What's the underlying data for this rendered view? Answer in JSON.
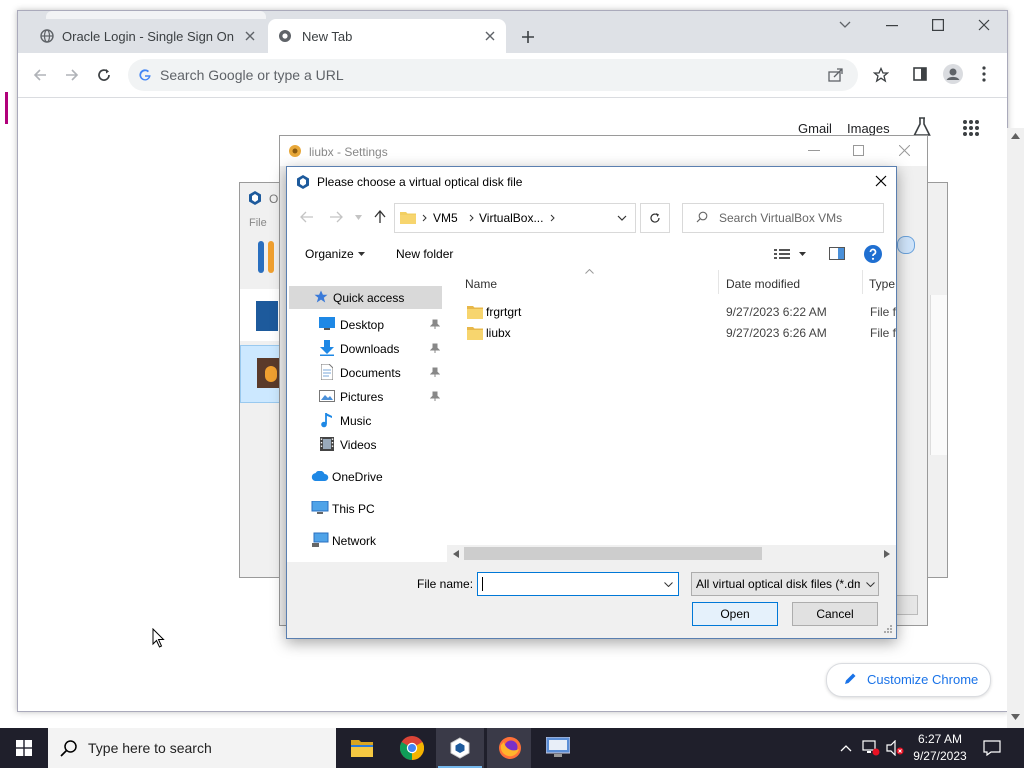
{
  "browser": {
    "tabs": [
      {
        "title": "Oracle Login - Single Sign On"
      },
      {
        "title": "New Tab"
      }
    ],
    "omnibox_placeholder": "Search Google or type a URL",
    "links": {
      "gmail": "Gmail",
      "images": "Images"
    },
    "customize_label": "Customize Chrome"
  },
  "vbox_manager": {
    "title_fragment": "O",
    "menu_file": "File"
  },
  "settings_window": {
    "title": "liubx - Settings"
  },
  "dialog": {
    "title": "Please choose a virtual optical disk file",
    "breadcrumb": [
      "VM5",
      "VirtualBox..."
    ],
    "search_placeholder": "Search VirtualBox VMs",
    "toolbar": {
      "organize": "Organize",
      "new_folder": "New folder"
    },
    "nav": {
      "quick_access": "Quick access",
      "items": [
        "Desktop",
        "Downloads",
        "Documents",
        "Pictures",
        "Music",
        "Videos"
      ],
      "onedrive": "OneDrive",
      "this_pc": "This PC",
      "network": "Network"
    },
    "columns": {
      "name": "Name",
      "date": "Date modified",
      "type": "Type"
    },
    "files": [
      {
        "name": "frgrtgrt",
        "date": "9/27/2023 6:22 AM",
        "type": "File fo"
      },
      {
        "name": "liubx",
        "date": "9/27/2023 6:26 AM",
        "type": "File fo"
      }
    ],
    "file_name_label": "File name:",
    "file_name_value": "",
    "filter": "All virtual optical disk files (*.dm",
    "open": "Open",
    "cancel": "Cancel"
  },
  "taskbar": {
    "search_placeholder": "Type here to search",
    "time": "6:27 AM",
    "date": "9/27/2023"
  },
  "colors": {
    "accent": "#1a73e8",
    "selection": "#cce8ff",
    "taskbar": "#1f1f2b"
  }
}
